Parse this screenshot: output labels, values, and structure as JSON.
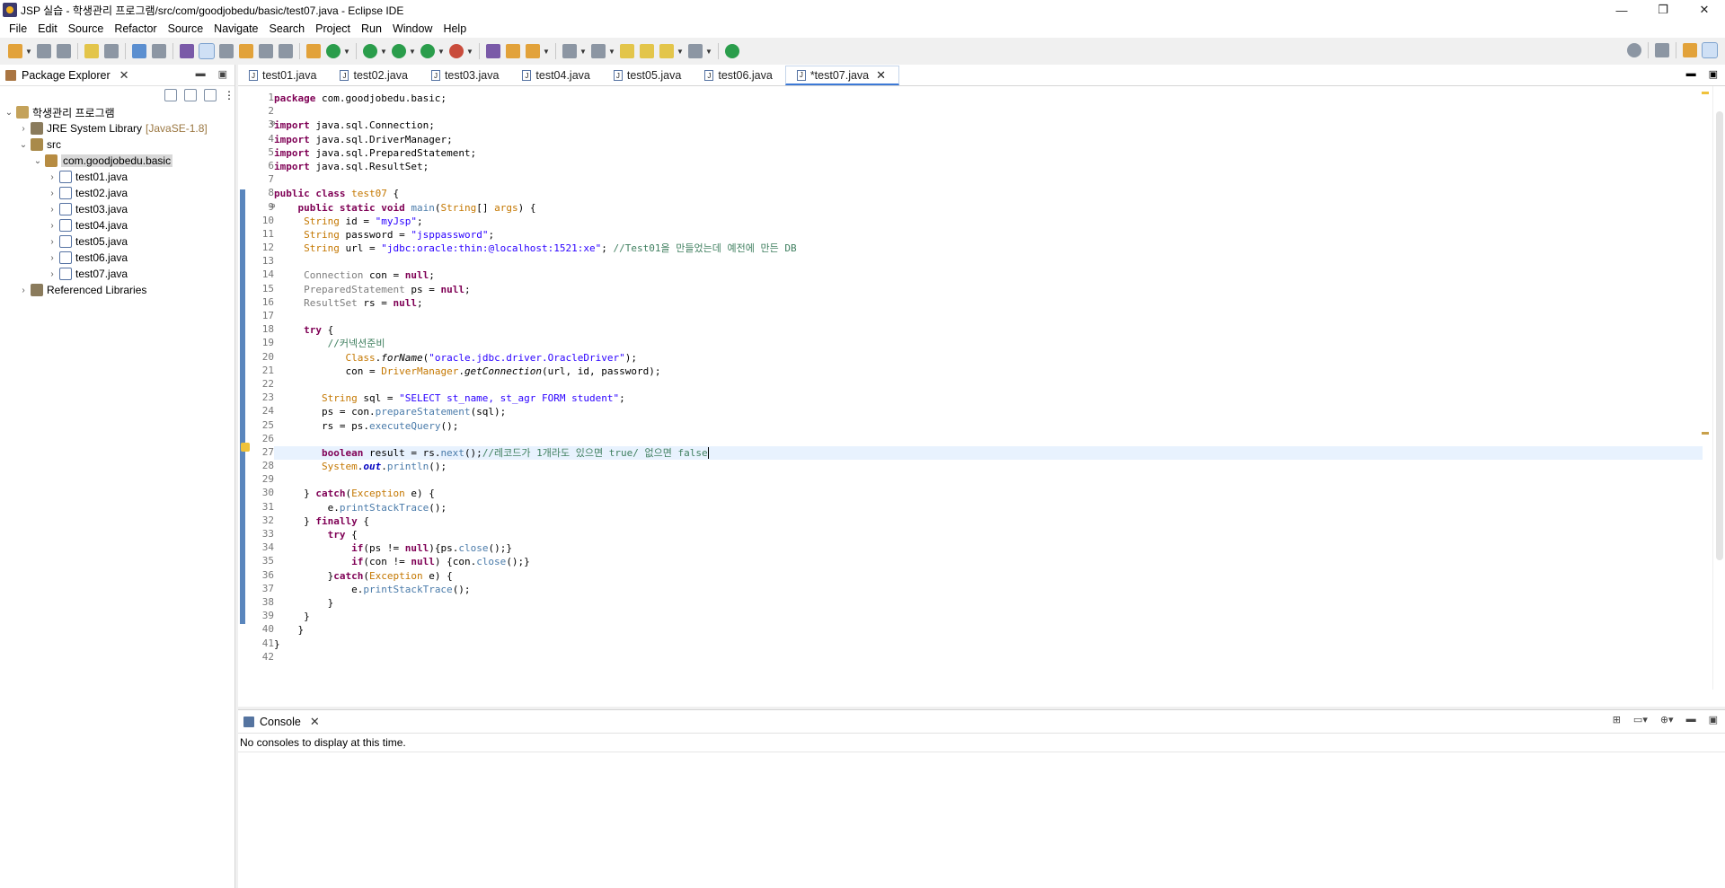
{
  "window": {
    "title": "JSP 실습 - 학생관리 프로그램/src/com/goodjobedu/basic/test07.java - Eclipse IDE",
    "controls": [
      "—",
      "❐",
      "✕"
    ]
  },
  "menu": [
    "File",
    "Edit",
    "Source",
    "Refactor",
    "Source",
    "Navigate",
    "Search",
    "Project",
    "Run",
    "Window",
    "Help"
  ],
  "package_explorer": {
    "tab_label": "Package Explorer",
    "tree": [
      {
        "label": "학생관리 프로그램",
        "icon": "project-icon",
        "expanded": true
      },
      {
        "label": "JRE System Library",
        "decoration": "[JavaSE-1.8]",
        "icon": "library-icon"
      },
      {
        "label": "src",
        "icon": "source-folder-icon",
        "expanded": true
      },
      {
        "label": "com.goodjobedu.basic",
        "icon": "package-icon",
        "expanded": true
      },
      {
        "label": "test01.java",
        "icon": "java-file-icon"
      },
      {
        "label": "test02.java",
        "icon": "java-file-icon"
      },
      {
        "label": "test03.java",
        "icon": "java-file-icon"
      },
      {
        "label": "test04.java",
        "icon": "java-file-icon"
      },
      {
        "label": "test05.java",
        "icon": "java-file-icon"
      },
      {
        "label": "test06.java",
        "icon": "java-file-icon"
      },
      {
        "label": "test07.java",
        "icon": "java-file-icon"
      },
      {
        "label": "Referenced Libraries",
        "icon": "library-icon"
      }
    ]
  },
  "editor": {
    "tabs": [
      "test01.java",
      "test02.java",
      "test03.java",
      "test04.java",
      "test05.java",
      "test06.java",
      "*test07.java"
    ],
    "active_tab": 6,
    "line_numbers": [
      "1",
      "2",
      "3",
      "4",
      "5",
      "6",
      "7",
      "8",
      "9",
      "10",
      "11",
      "12",
      "13",
      "14",
      "15",
      "16",
      "17",
      "18",
      "19",
      "20",
      "21",
      "22",
      "23",
      "24",
      "25",
      "26",
      "27",
      "28",
      "29",
      "30",
      "31",
      "32",
      "33",
      "34",
      "35",
      "36",
      "37",
      "38",
      "39",
      "40",
      "41",
      "42"
    ],
    "current_line": 27
  },
  "console": {
    "tab_label": "Console",
    "message": "No consoles to display at this time."
  },
  "colors": {
    "keyword": "#7f0055",
    "string": "#2a00ff",
    "comment": "#3f7f5f",
    "accent": "#3c79d6"
  }
}
